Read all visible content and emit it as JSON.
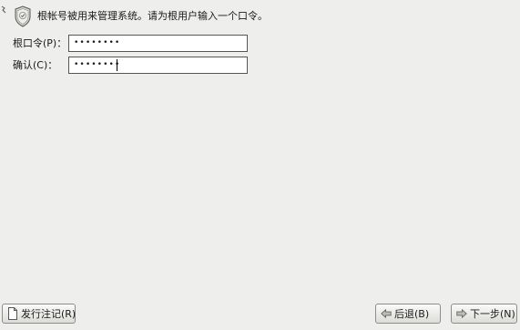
{
  "intro": {
    "text": "根帐号被用来管理系统。请为根用户输入一个口令。"
  },
  "fields": {
    "root_password": {
      "label": "根口令(P)：",
      "masked_value": "••••••••"
    },
    "confirm_password": {
      "label": "确认(C)：",
      "masked_value": "••••••••"
    }
  },
  "buttons": {
    "release_notes": "发行注记(R)",
    "back": "后退(B)",
    "next": "下一步(N)"
  },
  "icons": {
    "intro": "shield-icon",
    "release_notes": "document-icon",
    "back": "arrow-left-icon",
    "next": "arrow-right-icon"
  }
}
